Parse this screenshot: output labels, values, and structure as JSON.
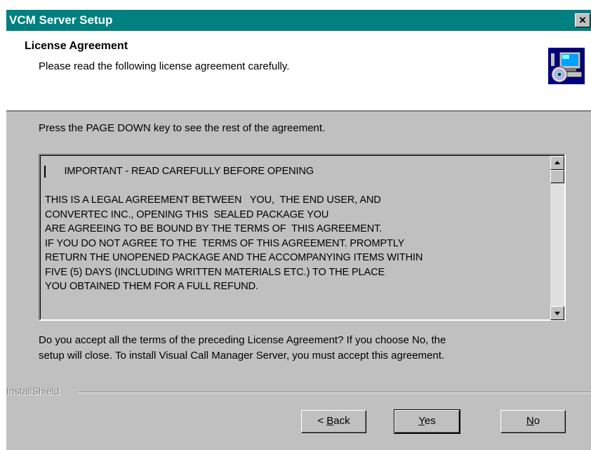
{
  "window": {
    "title": "VCM Server Setup",
    "close_label": "×"
  },
  "header": {
    "title": "License Agreement",
    "subtitle": "Please read the following license agreement carefully.",
    "icon": "setup-computer-cd-icon"
  },
  "instructions": "Press the PAGE DOWN key to see the rest of the agreement.",
  "license": {
    "lines": [
      "       IMPORTANT - READ CAREFULLY BEFORE OPENING",
      "",
      "THIS IS A LEGAL AGREEMENT BETWEEN   YOU,  THE END USER, AND",
      "CONVERTEC INC., OPENING THIS  SEALED PACKAGE YOU",
      "ARE AGREEING TO BE BOUND BY THE TERMS OF  THIS AGREEMENT.",
      "IF YOU DO NOT AGREE TO THE  TERMS OF THIS AGREEMENT. PROMPTLY",
      "RETURN THE UNOPENED PACKAGE AND THE ACCOMPANYING ITEMS WITHIN",
      "FIVE (5) DAYS (INCLUDING WRITTEN MATERIALS ETC.) TO THE PLACE",
      "YOU OBTAINED THEM FOR A FULL REFUND."
    ]
  },
  "question": {
    "line1": "Do you accept all the terms of the preceding License Agreement?  If you choose No,  the",
    "line2": "setup will close.  To install Visual Call Manager Server, you must accept this agreement."
  },
  "footer": {
    "brand": "InstallShield"
  },
  "buttons": {
    "back_prefix": "< ",
    "back_hotkey": "B",
    "back_rest": "ack",
    "yes_hotkey": "Y",
    "yes_rest": "es",
    "no_hotkey": "N",
    "no_rest": "o"
  },
  "colors": {
    "titlebar": "#008080",
    "dialog": "#c0c0c0"
  }
}
